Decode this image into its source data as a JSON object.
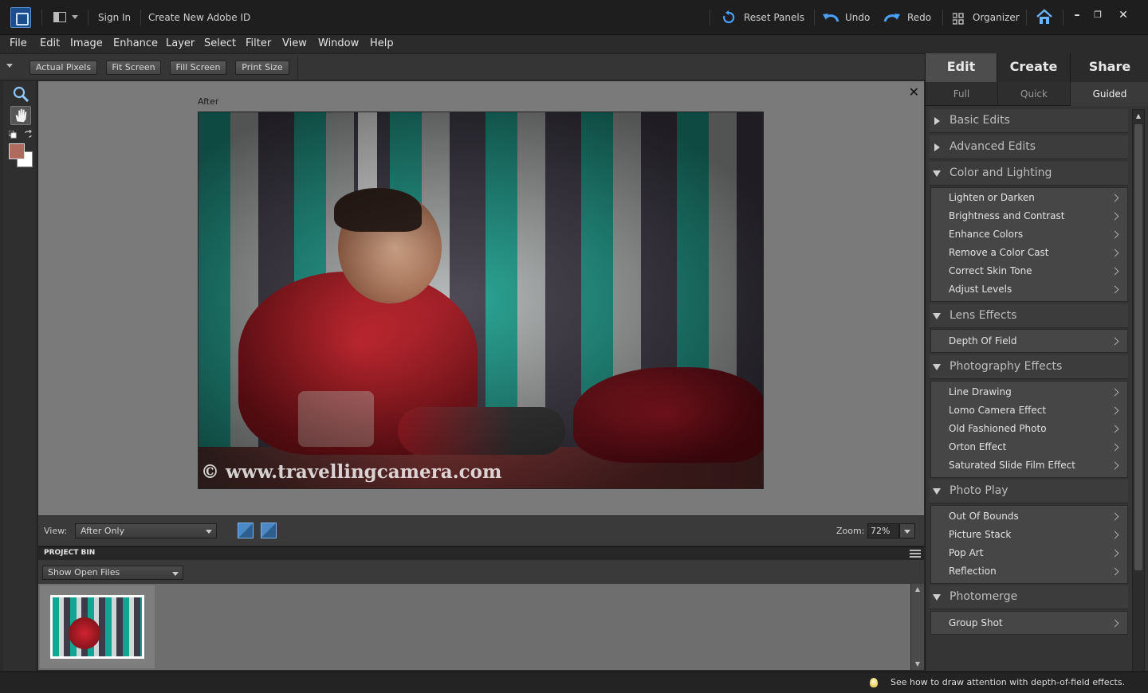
{
  "topbar": {
    "sign_in": "Sign In",
    "create_id": "Create New Adobe ID",
    "reset_panels": "Reset Panels",
    "undo": "Undo",
    "redo": "Redo",
    "organizer": "Organizer"
  },
  "menu": [
    "File",
    "Edit",
    "Image",
    "Enhance",
    "Layer",
    "Select",
    "Filter",
    "View",
    "Window",
    "Help"
  ],
  "options_bar": {
    "actual_pixels": "Actual Pixels",
    "fit_screen": "Fit Screen",
    "fill_screen": "Fill Screen",
    "print_size": "Print Size"
  },
  "tools": {
    "foreground_color": "#b06a5e",
    "background_color": "#ffffff"
  },
  "canvas": {
    "label": "After",
    "watermark": "© www.travellingcamera.com"
  },
  "view_bar": {
    "view_label": "View:",
    "view_value": "After Only",
    "zoom_label": "Zoom:",
    "zoom_value": "72%"
  },
  "project_bin": {
    "title": "PROJECT BIN",
    "filter": "Show Open Files"
  },
  "right_panel": {
    "tabs": [
      "Edit",
      "Create",
      "Share"
    ],
    "subtabs": [
      "Full",
      "Quick",
      "Guided"
    ],
    "sections": [
      {
        "title": "Basic Edits",
        "expanded": false,
        "items": []
      },
      {
        "title": "Advanced Edits",
        "expanded": false,
        "items": []
      },
      {
        "title": "Color and Lighting",
        "expanded": true,
        "items": [
          "Lighten or Darken",
          "Brightness and Contrast",
          "Enhance Colors",
          "Remove a Color Cast",
          "Correct Skin Tone",
          "Adjust Levels"
        ]
      },
      {
        "title": "Lens Effects",
        "expanded": true,
        "items": [
          "Depth Of Field"
        ]
      },
      {
        "title": "Photography Effects",
        "expanded": true,
        "items": [
          "Line Drawing",
          "Lomo Camera Effect",
          "Old Fashioned Photo",
          "Orton Effect",
          "Saturated Slide Film Effect"
        ]
      },
      {
        "title": "Photo Play",
        "expanded": true,
        "items": [
          "Out Of Bounds",
          "Picture Stack",
          "Pop Art",
          "Reflection"
        ]
      },
      {
        "title": "Photomerge",
        "expanded": true,
        "items": [
          "Group Shot"
        ]
      }
    ]
  },
  "status": {
    "tip": "See how to draw attention with depth-of-field effects."
  },
  "icons": [
    "app-logo-icon",
    "layout-icon",
    "reset-panels-icon",
    "undo-icon",
    "redo-icon",
    "organizer-icon",
    "home-icon",
    "zoom-tool-icon",
    "hand-tool-icon",
    "bulb-icon"
  ]
}
